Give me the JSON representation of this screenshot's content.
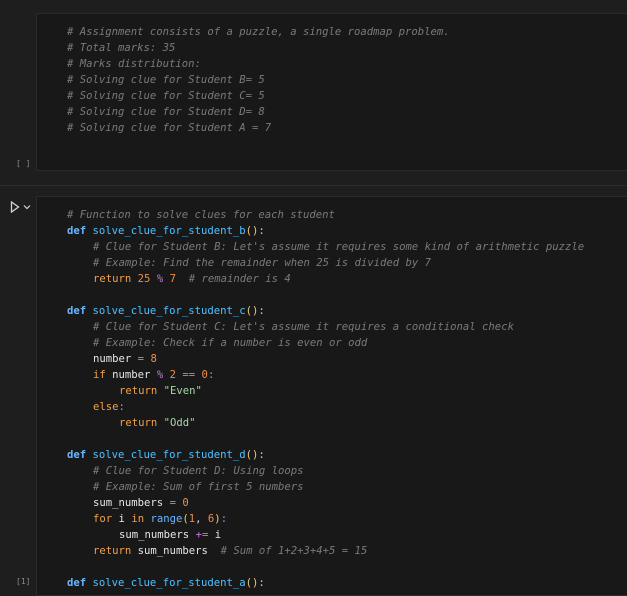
{
  "cell1": {
    "exec_count": "[ ]",
    "lines": [
      "# Assignment consists of a puzzle, a single roadmap problem.",
      "# Total marks: 35",
      "# Marks distribution:",
      "# Solving clue for Student B= 5",
      "# Solving clue for Student C= 5",
      "# Solving clue for Student D= 8",
      "# Solving clue for Student A = 7"
    ]
  },
  "cell2": {
    "exec_count": "[1]",
    "comment_header": "# Function to solve clues for each student",
    "def_b": "solve_clue_for_student_b",
    "b_c1": "# Clue for Student B: Let's assume it requires some kind of arithmetic puzzle",
    "b_c2": "# Example: Find the remainder when 25 is divided by 7",
    "b_ret_a": "25",
    "b_ret_b": "7",
    "b_ret_c": "# remainder is 4",
    "def_c": "solve_clue_for_student_c",
    "c_c1": "# Clue for Student C: Let's assume it requires a conditional check",
    "c_c2": "# Example: Check if a number is even or odd",
    "c_num_val": "8",
    "c_mod": "2",
    "c_zero": "0",
    "c_even": "\"Even\"",
    "c_odd": "\"Odd\"",
    "def_d": "solve_clue_for_student_d",
    "d_c1": "# Clue for Student D: Using loops",
    "d_c2": "# Example: Sum of first 5 numbers",
    "d_zero": "0",
    "d_r1": "1",
    "d_r2": "6",
    "d_ret_c": "# Sum of 1+2+3+4+5 = 15",
    "def_a": "solve_clue_for_student_a"
  },
  "keywords": {
    "def": "def",
    "return": "return",
    "if": "if",
    "else": "else",
    "for": "for",
    "in": "in",
    "range": "range",
    "number": "number",
    "sum_numbers": "sum_numbers",
    "i": "i"
  },
  "colors": {
    "background": "#1e1e1e",
    "cell_background": "#181818",
    "comment": "#7a7a7a",
    "keyword": "#6cb6ff",
    "number": "#f08d49",
    "string": "#a5d6a7"
  },
  "icons": {
    "run": "play-icon",
    "expand": "chevron-down-icon"
  }
}
